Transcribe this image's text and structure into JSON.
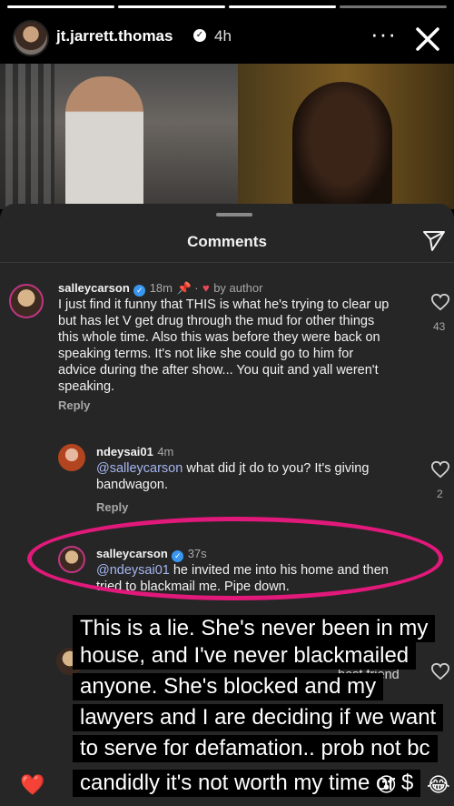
{
  "story": {
    "username": "jt.jarrett.thomas",
    "time": "4h",
    "more_label": "···"
  },
  "comments_sheet": {
    "title": "Comments",
    "comments": [
      {
        "username": "salleycarson",
        "time": "18m",
        "liked_by": "by author",
        "text": "I just find it funny that THIS is what he's trying to clear up but has let V get drug through the mud for other things this whole time. Also this was before they were back on speaking terms. It's not like she could go to him for advice during the after show... You quit and yall weren't speaking.",
        "reply_label": "Reply",
        "likes": "43"
      },
      {
        "username": "ndeysai01",
        "time": "4m",
        "mention": "@salleycarson",
        "text": " what did jt do to you? It's giving bandwagon.",
        "reply_label": "Reply",
        "likes": "2"
      },
      {
        "username": "salleycarson",
        "time": "37s",
        "mention": "@ndeysai01",
        "text": " he invited me into his home and then tried to blackmail me. Pipe down."
      },
      {
        "partial_text": "best friend"
      }
    ]
  },
  "caption_lines": [
    "This is a lie.  She's never been in my",
    "house, and I've never blackmailed",
    "anyone.  She's blocked and my",
    "lawyers and I are deciding if we want",
    "to serve for defamation.. prob not bc",
    "candidly it's not worth my time or $"
  ],
  "reactions": [
    "❤️",
    "😮",
    "😂"
  ],
  "colors": {
    "sheet_bg": "#262626",
    "mention": "#a4b6f0",
    "annotation": "#e0197a",
    "verified": "#3897f0"
  }
}
